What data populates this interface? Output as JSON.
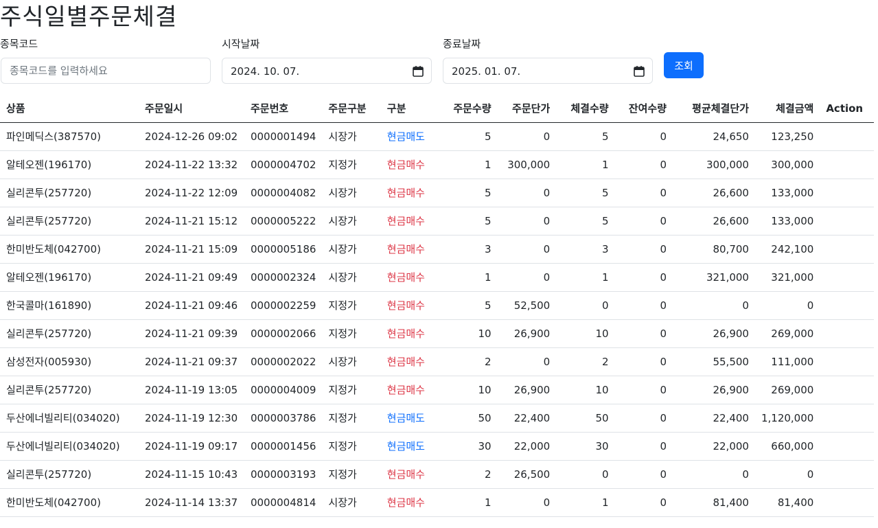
{
  "page": {
    "title": "주식일별주문체결"
  },
  "search": {
    "code_label": "종목코드",
    "code_placeholder": "종목코드를 입력하세요",
    "code_value": "",
    "start_label": "시작날짜",
    "start_value": "2024. 10. 07.",
    "end_label": "종료날짜",
    "end_value": "2025. 01. 07.",
    "button_label": "조회",
    "calendar_icon": "calendar-icon"
  },
  "colors": {
    "sell": "#0d6efd",
    "buy": "#dc3545",
    "primary": "#0d6efd"
  },
  "table": {
    "headers": [
      "상품",
      "주문일시",
      "주문번호",
      "주문구분",
      "구분",
      "주문수량",
      "주문단가",
      "체결수량",
      "잔여수량",
      "평균체결단가",
      "체결금액",
      "Action"
    ],
    "rows": [
      {
        "product": "파인메딕스(387570)",
        "datetime": "2024-12-26 09:02",
        "order_no": "0000001494",
        "order_type": "시장가",
        "side": "현금매도",
        "side_kind": "sell",
        "qty": "5",
        "price": "0",
        "filled": "5",
        "remaining": "0",
        "avg_price": "24,650",
        "amount": "123,250"
      },
      {
        "product": "알테오젠(196170)",
        "datetime": "2024-11-22 13:32",
        "order_no": "0000004702",
        "order_type": "지정가",
        "side": "현금매수",
        "side_kind": "buy",
        "qty": "1",
        "price": "300,000",
        "filled": "1",
        "remaining": "0",
        "avg_price": "300,000",
        "amount": "300,000"
      },
      {
        "product": "실리콘투(257720)",
        "datetime": "2024-11-22 12:09",
        "order_no": "0000004082",
        "order_type": "시장가",
        "side": "현금매수",
        "side_kind": "buy",
        "qty": "5",
        "price": "0",
        "filled": "5",
        "remaining": "0",
        "avg_price": "26,600",
        "amount": "133,000"
      },
      {
        "product": "실리콘투(257720)",
        "datetime": "2024-11-21 15:12",
        "order_no": "0000005222",
        "order_type": "시장가",
        "side": "현금매수",
        "side_kind": "buy",
        "qty": "5",
        "price": "0",
        "filled": "5",
        "remaining": "0",
        "avg_price": "26,600",
        "amount": "133,000"
      },
      {
        "product": "한미반도체(042700)",
        "datetime": "2024-11-21 15:09",
        "order_no": "0000005186",
        "order_type": "시장가",
        "side": "현금매수",
        "side_kind": "buy",
        "qty": "3",
        "price": "0",
        "filled": "3",
        "remaining": "0",
        "avg_price": "80,700",
        "amount": "242,100"
      },
      {
        "product": "알테오젠(196170)",
        "datetime": "2024-11-21 09:49",
        "order_no": "0000002324",
        "order_type": "시장가",
        "side": "현금매수",
        "side_kind": "buy",
        "qty": "1",
        "price": "0",
        "filled": "1",
        "remaining": "0",
        "avg_price": "321,000",
        "amount": "321,000"
      },
      {
        "product": "한국콜마(161890)",
        "datetime": "2024-11-21 09:46",
        "order_no": "0000002259",
        "order_type": "지정가",
        "side": "현금매수",
        "side_kind": "buy",
        "qty": "5",
        "price": "52,500",
        "filled": "0",
        "remaining": "0",
        "avg_price": "0",
        "amount": "0"
      },
      {
        "product": "실리콘투(257720)",
        "datetime": "2024-11-21 09:39",
        "order_no": "0000002066",
        "order_type": "지정가",
        "side": "현금매수",
        "side_kind": "buy",
        "qty": "10",
        "price": "26,900",
        "filled": "10",
        "remaining": "0",
        "avg_price": "26,900",
        "amount": "269,000"
      },
      {
        "product": "삼성전자(005930)",
        "datetime": "2024-11-21 09:37",
        "order_no": "0000002022",
        "order_type": "시장가",
        "side": "현금매수",
        "side_kind": "buy",
        "qty": "2",
        "price": "0",
        "filled": "2",
        "remaining": "0",
        "avg_price": "55,500",
        "amount": "111,000"
      },
      {
        "product": "실리콘투(257720)",
        "datetime": "2024-11-19 13:05",
        "order_no": "0000004009",
        "order_type": "지정가",
        "side": "현금매수",
        "side_kind": "buy",
        "qty": "10",
        "price": "26,900",
        "filled": "10",
        "remaining": "0",
        "avg_price": "26,900",
        "amount": "269,000"
      },
      {
        "product": "두산에너빌리티(034020)",
        "datetime": "2024-11-19 12:30",
        "order_no": "0000003786",
        "order_type": "지정가",
        "side": "현금매도",
        "side_kind": "sell",
        "qty": "50",
        "price": "22,400",
        "filled": "50",
        "remaining": "0",
        "avg_price": "22,400",
        "amount": "1,120,000"
      },
      {
        "product": "두산에너빌리티(034020)",
        "datetime": "2024-11-19 09:17",
        "order_no": "0000001456",
        "order_type": "지정가",
        "side": "현금매도",
        "side_kind": "sell",
        "qty": "30",
        "price": "22,000",
        "filled": "30",
        "remaining": "0",
        "avg_price": "22,000",
        "amount": "660,000"
      },
      {
        "product": "실리콘투(257720)",
        "datetime": "2024-11-15 10:43",
        "order_no": "0000003193",
        "order_type": "지정가",
        "side": "현금매수",
        "side_kind": "buy",
        "qty": "2",
        "price": "26,500",
        "filled": "0",
        "remaining": "0",
        "avg_price": "0",
        "amount": "0"
      },
      {
        "product": "한미반도체(042700)",
        "datetime": "2024-11-14 13:37",
        "order_no": "0000004814",
        "order_type": "시장가",
        "side": "현금매수",
        "side_kind": "buy",
        "qty": "1",
        "price": "0",
        "filled": "1",
        "remaining": "0",
        "avg_price": "81,400",
        "amount": "81,400"
      }
    ]
  }
}
